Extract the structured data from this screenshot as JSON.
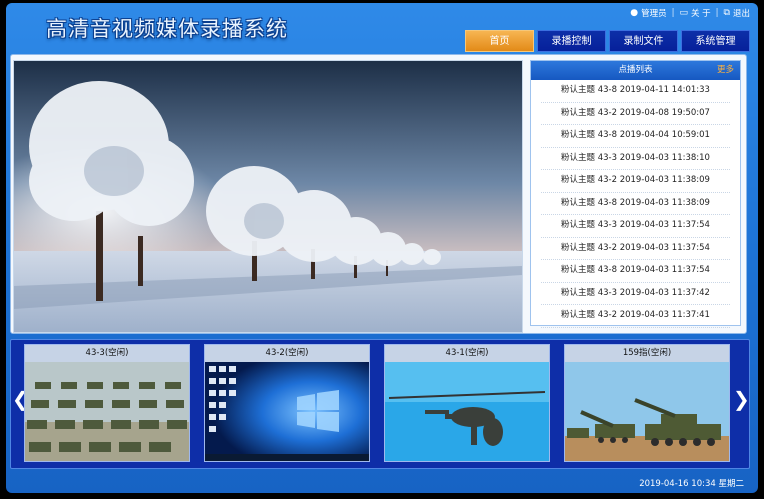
{
  "app": {
    "title": "高清音视频媒体录播系统",
    "colors": {
      "accent": "#f0a030",
      "brand": "#1d73d6",
      "panel_dark": "#0e2ea8"
    }
  },
  "toplinks": {
    "admin": "管理员",
    "about": "关 于",
    "logout": "退出"
  },
  "nav": {
    "tabs": [
      {
        "label": "首页",
        "active": true
      },
      {
        "label": "录播控制",
        "active": false
      },
      {
        "label": "录制文件",
        "active": false
      },
      {
        "label": "系统管理",
        "active": false
      }
    ]
  },
  "events": {
    "title": "点播列表",
    "more": "更多",
    "items": [
      "粉认主题 43-8 2019-04-11 14:01:33",
      "粉认主题 43-2 2019-04-08 19:50:07",
      "粉认主题 43-8 2019-04-04 10:59:01",
      "粉认主题 43-3 2019-04-03 11:38:10",
      "粉认主题 43-2 2019-04-03 11:38:09",
      "粉认主题 43-8 2019-04-03 11:38:09",
      "粉认主题 43-3 2019-04-03 11:37:54",
      "粉认主题 43-2 2019-04-03 11:37:54",
      "粉认主题 43-8 2019-04-03 11:37:54",
      "粉认主题 43-3 2019-04-03 11:37:42",
      "粉认主题 43-2 2019-04-03 11:37:41"
    ]
  },
  "cameras": [
    {
      "label": "43-3(空闲)",
      "scene": "parade"
    },
    {
      "label": "43-2(空闲)",
      "scene": "desktop"
    },
    {
      "label": "43-1(空闲)",
      "scene": "helicopter"
    },
    {
      "label": "159指(空闲)",
      "scene": "artillery"
    }
  ],
  "carousel": {
    "prev_icon": "chevron-left-icon",
    "next_icon": "chevron-right-icon"
  },
  "status": {
    "datetime": "2019-04-16 10:34 星期二"
  }
}
